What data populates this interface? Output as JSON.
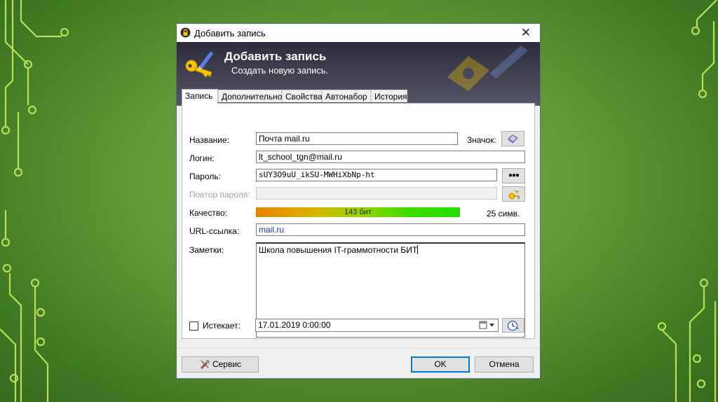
{
  "window": {
    "title": "Добавить запись",
    "close_glyph": "✕"
  },
  "banner": {
    "title": "Добавить запись",
    "subtitle": "Создать новую запись."
  },
  "tabs": [
    {
      "label": "Запись"
    },
    {
      "label": "Дополнительно"
    },
    {
      "label": "Свойства"
    },
    {
      "label": "Автонабор"
    },
    {
      "label": "История"
    }
  ],
  "form": {
    "title_label": "Название:",
    "title_value": "Почта mail.ru",
    "icon_label": "Значок:",
    "login_label": "Логин:",
    "login_value": "lt_school_tgn@mail.ru",
    "password_label": "Пароль:",
    "password_value": "sUY3O9uU_ikSU-MWHiXbNp-ht",
    "show_password_glyph": "●●●",
    "repeat_label": "Повтор пароля:",
    "quality_label": "Качество:",
    "quality_text": "143 бит",
    "quality_fraction": 1.0,
    "char_count": "25 симв.",
    "url_label": "URL-ссылка:",
    "url_value": "mail.ru",
    "notes_label": "Заметки:",
    "notes_value": "Школа повышения IT-граммотности БИТ",
    "expires_label": "Истекает:",
    "expires_checked": false,
    "expires_value": "17.01.2019   0:00:00"
  },
  "buttons": {
    "tools": "Сервис",
    "ok": "OK",
    "cancel": "Отмена"
  },
  "icons": {
    "app": "lock-icon",
    "banner": "key-pencil-icon",
    "entry_icon": "entry-icon-picker",
    "generator": "password-generator-icon",
    "calendar": "calendar-icon",
    "expiry": "clock-icon",
    "tools": "tools-icon"
  },
  "colors": {
    "background": "#5f9a36",
    "banner": "#434353",
    "link": "#2233bb",
    "default_button": "#0078d7"
  }
}
